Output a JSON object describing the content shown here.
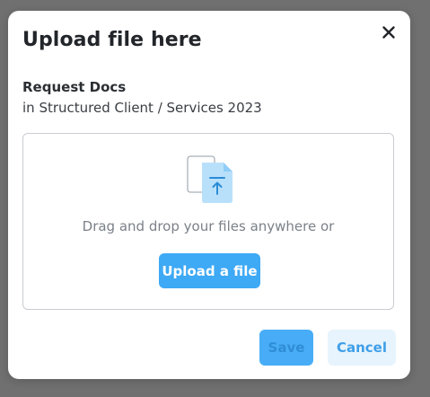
{
  "modal": {
    "title": "Upload file here",
    "close_icon": "close-icon",
    "subtitle": "Request Docs",
    "path": "in Structured Client / Services 2023"
  },
  "dropzone": {
    "icon": "file-upload-icon",
    "text": "Drag and drop your files anywhere or",
    "upload_label": "Upload a file"
  },
  "actions": {
    "save_label": "Save",
    "cancel_label": "Cancel"
  },
  "colors": {
    "accent": "#3ea9f5",
    "save_disabled_bg": "#45acf6",
    "cancel_bg": "#e7f4fd",
    "overlay": "#707070"
  }
}
